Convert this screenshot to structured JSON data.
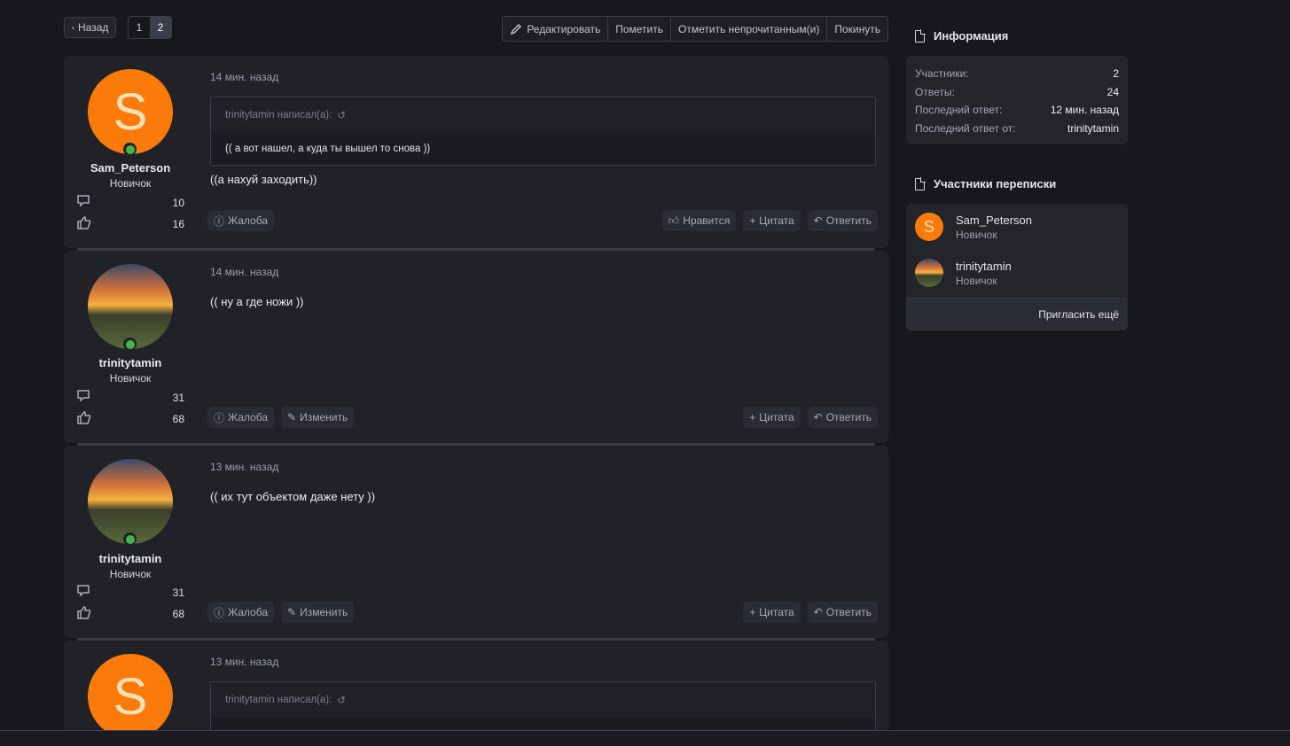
{
  "topbar": {
    "back_label": "Назад",
    "pages": [
      "1",
      "2"
    ],
    "current_page": "2",
    "actions": [
      "Редактировать",
      "Пометить",
      "Отметить непрочитанным(и)",
      "Покинуть"
    ]
  },
  "posts": [
    {
      "avatar_letter": "S",
      "username": "Sam_Peterson",
      "user_title": "Новичок",
      "messages_count": "10",
      "likes_count": "16",
      "time": "14 мин. назад",
      "quote_author": "trinitytamin написал(а):",
      "quote_text": "(( а вот нашел, а куда ты вышел то снова ))",
      "message": "((а нахуй заходить))",
      "footer_left": [
        "Жалоба"
      ],
      "footer_right": [
        "Нравится",
        "Цитата",
        "Ответить"
      ]
    },
    {
      "username": "trinitytamin",
      "user_title": "Новичок",
      "messages_count": "31",
      "likes_count": "68",
      "time": "14 мин. назад",
      "message": "(( ну а где ножи ))",
      "footer_left": [
        "Жалоба",
        "Изменить"
      ],
      "footer_right": [
        "Цитата",
        "Ответить"
      ]
    },
    {
      "username": "trinitytamin",
      "user_title": "Новичок",
      "messages_count": "31",
      "likes_count": "68",
      "time": "13 мин. назад",
      "message": "(( их тут объектом даже нету ))",
      "footer_left": [
        "Жалоба",
        "Изменить"
      ],
      "footer_right": [
        "Цитата",
        "Ответить"
      ]
    },
    {
      "avatar_letter": "S",
      "time": "13 мин. назад",
      "quote_author": "trinitytamin написал(а):"
    }
  ],
  "sidebar": {
    "info_title": "Информация",
    "info_rows": [
      {
        "label": "Участники:",
        "value": "2"
      },
      {
        "label": "Ответы:",
        "value": "24"
      },
      {
        "label": "Последний ответ:",
        "value": "12 мин. назад"
      },
      {
        "label": "Последний ответ от:",
        "value": "trinitytamin"
      }
    ],
    "members_title": "Участники переписки",
    "members": [
      {
        "name": "Sam_Peterson",
        "title": "Новичок",
        "avatar_letter": "S"
      },
      {
        "name": "trinitytamin",
        "title": "Новичок"
      }
    ],
    "invite_label": "Пригласить ещё"
  },
  "colors": {
    "accent": "#fa7b0a",
    "online": "#47b34a",
    "background": "#17181c",
    "panel": "#202228"
  }
}
